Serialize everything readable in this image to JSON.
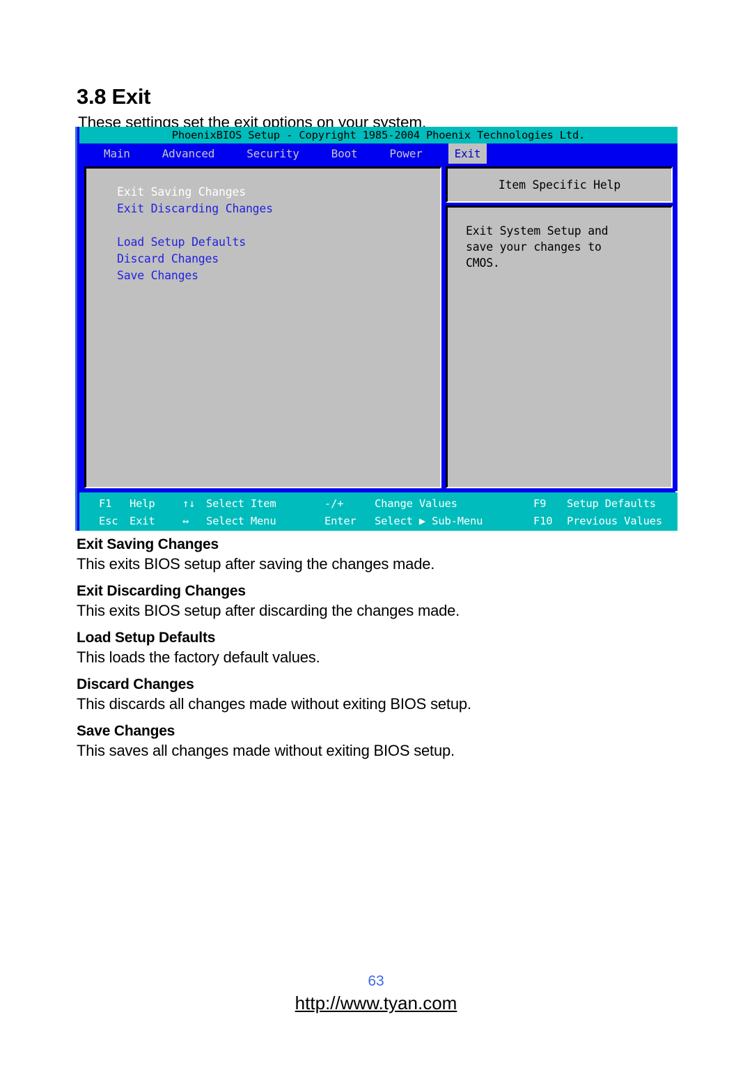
{
  "document": {
    "section_heading": "3.8 Exit",
    "intro": "These settings set the exit options on your system.",
    "page_number": "63",
    "footer_url": "http://www.tyan.com"
  },
  "bios": {
    "titlebar": "PhoenixBIOS Setup - Copyright 1985-2004 Phoenix Technologies Ltd.",
    "menu_tabs": [
      {
        "label": "Main",
        "active": false
      },
      {
        "label": "Advanced",
        "active": false
      },
      {
        "label": "Security",
        "active": false
      },
      {
        "label": "Boot",
        "active": false
      },
      {
        "label": "Power",
        "active": false
      },
      {
        "label": "Exit",
        "active": true
      }
    ],
    "menu_items": [
      {
        "label": "Exit Saving Changes",
        "selected": true
      },
      {
        "label": "Exit Discarding Changes",
        "selected": false
      },
      {
        "label": "Load Setup Defaults",
        "selected": false
      },
      {
        "label": "Discard Changes",
        "selected": false
      },
      {
        "label": "Save Changes",
        "selected": false
      }
    ],
    "help": {
      "header": "Item Specific Help",
      "line1": "Exit System Setup and",
      "line2": "save your changes to",
      "line3": "CMOS."
    },
    "keybar": {
      "row1": {
        "key1": "F1",
        "label1": "Help",
        "key2": "↑↓",
        "label2": "Select Item",
        "key3": "-/+",
        "label3": "Change Values",
        "key4": "F9",
        "label4": "Setup Defaults"
      },
      "row2": {
        "key1": "Esc",
        "label1": "Exit",
        "key2": "↔",
        "label2": "Select Menu",
        "key3": "Enter",
        "label3": "Select ▶ Sub-Menu",
        "key4": "F10",
        "label4": "Previous Values"
      }
    },
    "colors": {
      "titlebar_bg": "#00bcbc",
      "menubar_bg": "#0000f0",
      "panel_bg": "#c0c0c0",
      "item_text": "#2222dd",
      "selected_text": "#ffffff",
      "keybar_bg": "#00bcbc"
    }
  },
  "definitions": [
    {
      "term": "Exit Saving Changes",
      "desc": "This exits BIOS setup after saving the changes made."
    },
    {
      "term": "Exit Discarding Changes",
      "desc": "This exits BIOS setup after discarding the changes made."
    },
    {
      "term": "Load Setup Defaults",
      "desc": "This loads the factory default values."
    },
    {
      "term": "Discard Changes",
      "desc": "This discards all changes made without exiting BIOS setup."
    },
    {
      "term": "Save Changes",
      "desc": "This saves all changes made without exiting BIOS setup."
    }
  ]
}
